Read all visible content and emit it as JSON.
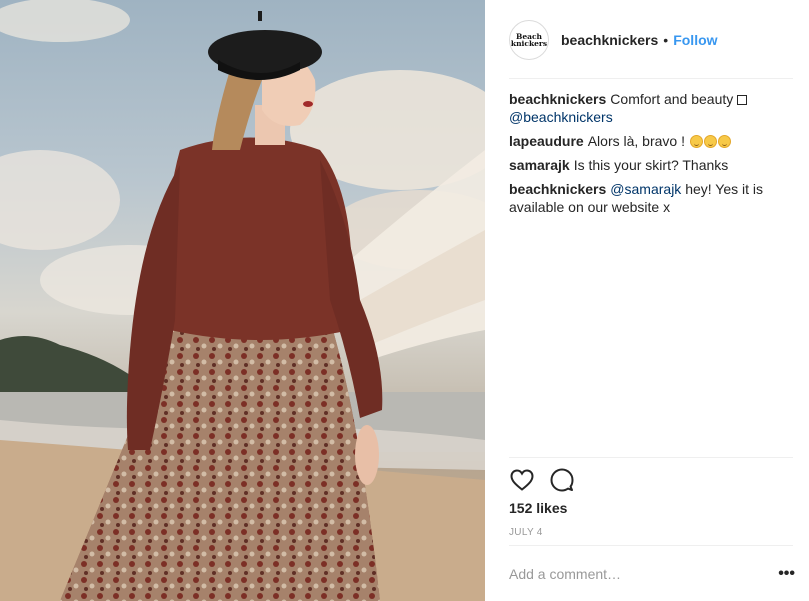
{
  "post": {
    "image_icon": "photo-woman-on-beach"
  },
  "header": {
    "avatar_text_line1": "Beach",
    "avatar_text_line2": "knickers",
    "username": "beachknickers",
    "separator": "•",
    "follow_label": "Follow"
  },
  "comments": [
    {
      "user": "beachknickers",
      "text": "Comfort and beauty",
      "suffix_icon": "box-glyph",
      "mention_line": "@beachknickers"
    },
    {
      "user": "lapeaudure",
      "text": "Alors là, bravo !",
      "emoji_count": 3
    },
    {
      "user": "samarajk",
      "text": "Is this your skirt? Thanks"
    },
    {
      "user": "beachknickers",
      "mention": "@samarajk",
      "text": "hey! Yes it is available on our website x"
    }
  ],
  "actions": {
    "like_icon": "heart-icon",
    "comment_icon": "comment-bubble-icon"
  },
  "likes": "152 likes",
  "date": "JULY 4",
  "comment_box": {
    "placeholder": "Add a comment…",
    "more_label": "•••"
  },
  "colors": {
    "link_blue": "#3897f0",
    "mention_blue": "#003569",
    "text": "#262626",
    "muted": "#999999"
  }
}
